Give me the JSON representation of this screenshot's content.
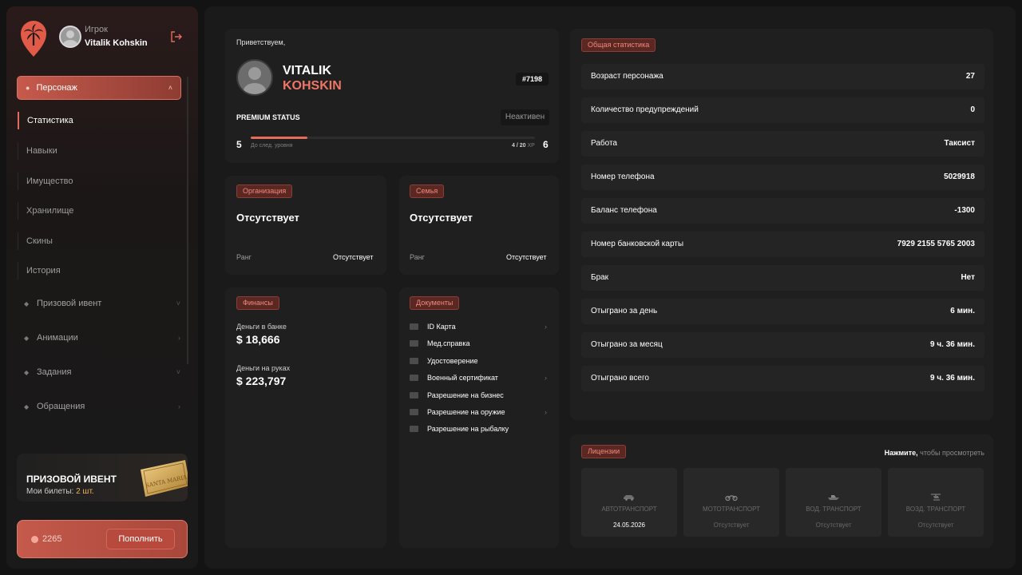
{
  "sidebar": {
    "user": {
      "role": "Игрок",
      "name": "Vitalik Kohskin"
    },
    "menu_active": "Персонаж",
    "submenu": [
      "Статистика",
      "Навыки",
      "Имущество",
      "Хранилище",
      "Скины",
      "История"
    ],
    "groups": [
      "Призовой ивент",
      "Анимации",
      "Задания",
      "Обращения"
    ],
    "event": {
      "title": "ПРИЗОВОЙ ИВЕНТ",
      "tickets_label": "Мои билеты:",
      "tickets_value": "2 шт.",
      "ticket_text": "SANTA MARIA"
    },
    "balance": {
      "value": "2265",
      "topup_label": "Пополнить"
    }
  },
  "profile": {
    "greeting": "Приветствуем,",
    "first_name": "VITALIK",
    "last_name": "KOHSKIN",
    "id": "#7198",
    "premium_label": "PREMIUM STATUS",
    "premium_status": "Неактивен",
    "level_current": "5",
    "level_next": "6",
    "next_level_label": "До след. уровня",
    "xp_current": "4",
    "xp_total": "20",
    "xp_unit": "XP",
    "xp_text": "4 / 20"
  },
  "organization": {
    "tag": "Организация",
    "value": "Отсутствует",
    "rank_label": "Ранг",
    "rank_value": "Отсутствует"
  },
  "family": {
    "tag": "Семья",
    "value": "Отсутствует",
    "rank_label": "Ранг",
    "rank_value": "Отсутствует"
  },
  "finance": {
    "tag": "Финансы",
    "bank_label": "Деньги в банке",
    "bank_value": "$ 18,666",
    "cash_label": "Деньги на руках",
    "cash_value": "$ 223,797"
  },
  "documents": {
    "tag": "Документы",
    "items": [
      {
        "label": "ID Карта",
        "chevron": true
      },
      {
        "label": "Мед.справка",
        "chevron": false
      },
      {
        "label": "Удостоверение",
        "chevron": false
      },
      {
        "label": "Военный сертификат",
        "chevron": true
      },
      {
        "label": "Разрешение на бизнес",
        "chevron": false
      },
      {
        "label": "Разрешение на оружие",
        "chevron": true
      },
      {
        "label": "Разрешение на рыбалку",
        "chevron": false
      }
    ]
  },
  "stats": {
    "tag": "Общая статистика",
    "rows": [
      {
        "k": "Возраст персонажа",
        "v": "27"
      },
      {
        "k": "Количество предупреждений",
        "v": "0"
      },
      {
        "k": "Работа",
        "v": "Таксист"
      },
      {
        "k": "Номер телефона",
        "v": "5029918"
      },
      {
        "k": "Баланс телефона",
        "v": "-1300"
      },
      {
        "k": "Номер банковской карты",
        "v": "7929 2155 5765 2003"
      },
      {
        "k": "Брак",
        "v": "Нет"
      },
      {
        "k": "Отыграно за день",
        "v": "6 мин."
      },
      {
        "k": "Отыграно за месяц",
        "v": "9 ч. 36 мин."
      },
      {
        "k": "Отыграно всего",
        "v": "9 ч. 36 мин."
      }
    ]
  },
  "licenses": {
    "tag": "Лицензии",
    "hint_bold": "Нажмите,",
    "hint_rest": " чтобы просмотреть",
    "items": [
      {
        "type": "АВТОТРАНСПОРТ",
        "value": "24.05.2026",
        "icon": "car-icon"
      },
      {
        "type": "МОТОТРАНСПОРТ",
        "value": "Отсутствует",
        "icon": "motorcycle-icon"
      },
      {
        "type": "ВОД. ТРАНСПОРТ",
        "value": "Отсутствует",
        "icon": "boat-icon"
      },
      {
        "type": "ВОЗД. ТРАНСПОРТ",
        "value": "Отсутствует",
        "icon": "helicopter-icon"
      }
    ]
  },
  "colors": {
    "accent": "#e86a5a",
    "background": "#1a1a1a",
    "panel": "#1f1f1f"
  }
}
